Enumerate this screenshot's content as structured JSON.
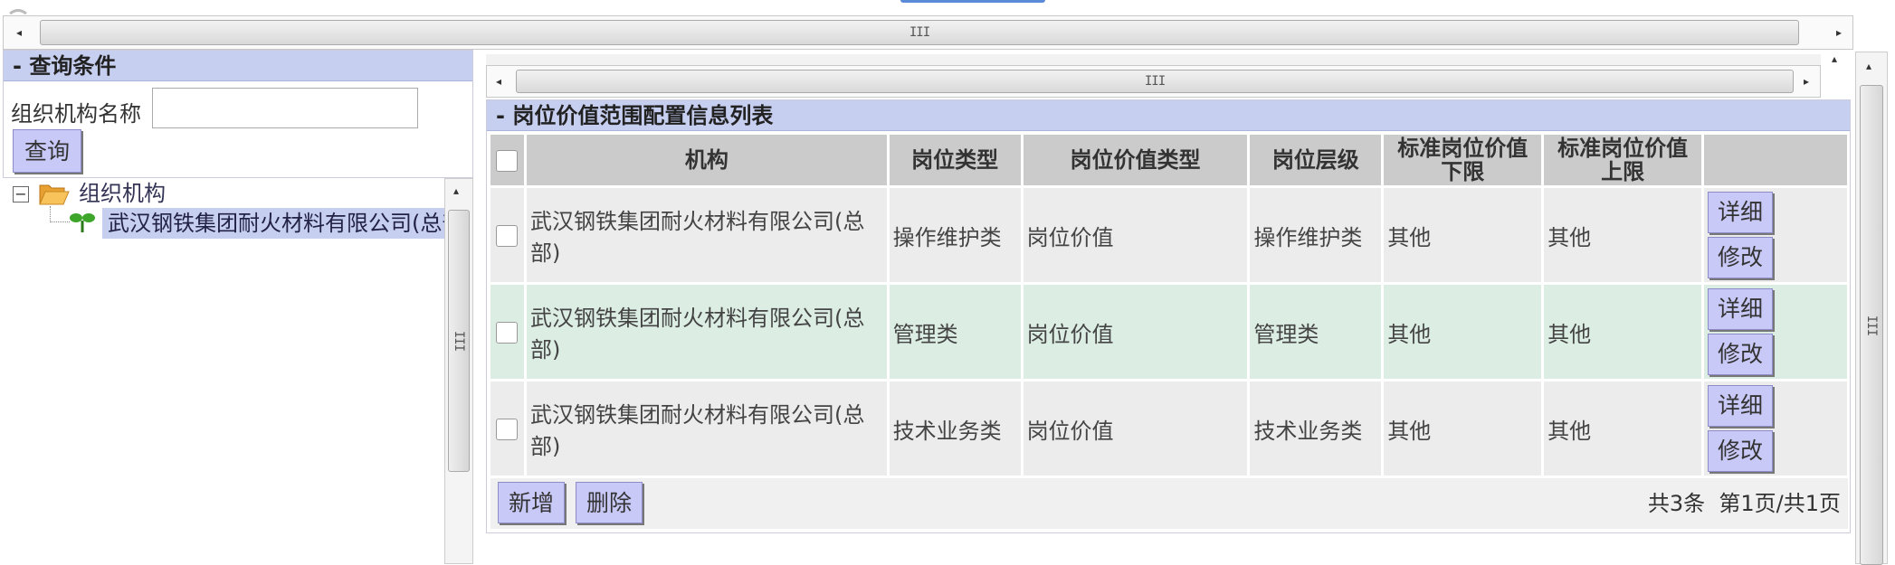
{
  "query": {
    "title": "- 查询条件",
    "org_label": "组织机构名称",
    "org_value": "",
    "search_label": "查询"
  },
  "tree": {
    "root_label": "组织机构",
    "child_label": "武汉钢铁集团耐火材料有限公司(总部)"
  },
  "grid": {
    "title": "- 岗位价值范围配置信息列表",
    "columns": {
      "org": "机构",
      "post_type": "岗位类型",
      "value_type": "岗位价值类型",
      "level": "岗位层级",
      "lower": "标准岗位价值下限",
      "upper": "标准岗位价值上限"
    },
    "rows": [
      {
        "org": "武汉钢铁集团耐火材料有限公司(总部)",
        "post_type": "操作维护类",
        "value_type": "岗位价值",
        "level": "操作维护类",
        "lower": "其他",
        "upper": "其他"
      },
      {
        "org": "武汉钢铁集团耐火材料有限公司(总部)",
        "post_type": "管理类",
        "value_type": "岗位价值",
        "level": "管理类",
        "lower": "其他",
        "upper": "其他"
      },
      {
        "org": "武汉钢铁集团耐火材料有限公司(总部)",
        "post_type": "技术业务类",
        "value_type": "岗位价值",
        "level": "技术业务类",
        "lower": "其他",
        "upper": "其他"
      }
    ],
    "detail_label": "详细",
    "edit_label": "修改",
    "add_label": "新增",
    "delete_label": "删除",
    "pager_text": "共3条  第1页/共1页"
  },
  "icons": {
    "folder": "folder-open-icon",
    "leaf": "org-leaf-icon",
    "collapse": "collapse-minus-icon"
  }
}
